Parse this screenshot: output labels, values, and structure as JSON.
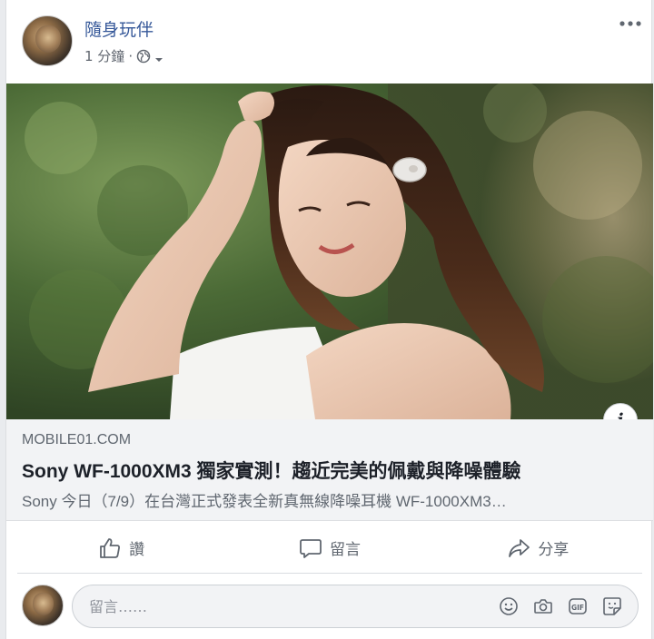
{
  "post": {
    "page_name": "隨身玩伴",
    "time": "1 分鐘",
    "separator": "·",
    "privacy_icon": "globe-icon",
    "more_icon": "more-dots-icon"
  },
  "link_preview": {
    "domain": "MOBILE01.COM",
    "title": "Sony WF-1000XM3 獨家實測！趨近完美的佩戴與降噪體驗",
    "description": "Sony 今日（7/9）在台灣正式發表全新真無線降噪耳機 WF-1000XM3…",
    "info_label": "i"
  },
  "actions": {
    "like": {
      "label": "讚",
      "icon": "thumbs-up-icon"
    },
    "comment": {
      "label": "留言",
      "icon": "speech-bubble-icon"
    },
    "share": {
      "label": "分享",
      "icon": "share-arrow-icon"
    }
  },
  "composer": {
    "placeholder": "留言……",
    "icons": [
      "emoji-icon",
      "camera-icon",
      "gif-icon",
      "sticker-icon"
    ]
  },
  "colors": {
    "link_blue": "#365899",
    "secondary_text": "#616770",
    "link_box_bg": "#f2f3f5",
    "page_bg": "#e9ebee"
  }
}
